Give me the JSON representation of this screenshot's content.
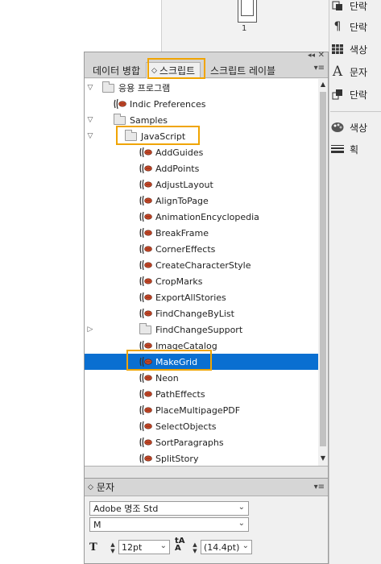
{
  "page_thumb": {
    "number": "1"
  },
  "right_panel": {
    "items": [
      {
        "label": "단락",
        "icon": "paragraph-style-icon"
      },
      {
        "label": "단락",
        "icon": "pilcrow-icon"
      },
      {
        "label": "색상",
        "icon": "swatch-grid-icon"
      },
      {
        "label": "문자",
        "icon": "character-icon"
      },
      {
        "label": "단락",
        "icon": "paragraph-styles-icon"
      },
      {
        "label": "색상",
        "icon": "color-palette-icon"
      },
      {
        "label": "획",
        "icon": "stroke-icon"
      }
    ]
  },
  "scripts_panel": {
    "tabs": [
      {
        "label": "데이터 병합"
      },
      {
        "label": "스크립트",
        "prefix": "◇"
      },
      {
        "label": "스크립트 레이블"
      }
    ],
    "tree": [
      {
        "label": "응용 프로그램",
        "type": "folder",
        "level": 0,
        "expanded": true
      },
      {
        "label": "Indic Preferences",
        "type": "script",
        "level": 1
      },
      {
        "label": "Samples",
        "type": "folder",
        "level": 1,
        "expanded": true
      },
      {
        "label": "JavaScript",
        "type": "folder",
        "level": 2,
        "expanded": true
      },
      {
        "label": "AddGuides",
        "type": "script",
        "level": 3
      },
      {
        "label": "AddPoints",
        "type": "script",
        "level": 3
      },
      {
        "label": "AdjustLayout",
        "type": "script",
        "level": 3
      },
      {
        "label": "AlignToPage",
        "type": "script",
        "level": 3
      },
      {
        "label": "AnimationEncyclopedia",
        "type": "script",
        "level": 3
      },
      {
        "label": "BreakFrame",
        "type": "script",
        "level": 3
      },
      {
        "label": "CornerEffects",
        "type": "script",
        "level": 3
      },
      {
        "label": "CreateCharacterStyle",
        "type": "script",
        "level": 3
      },
      {
        "label": "CropMarks",
        "type": "script",
        "level": 3
      },
      {
        "label": "ExportAllStories",
        "type": "script",
        "level": 3
      },
      {
        "label": "FindChangeByList",
        "type": "script",
        "level": 3
      },
      {
        "label": "FindChangeSupport",
        "type": "folder",
        "level": 3,
        "expanded": false
      },
      {
        "label": "ImageCatalog",
        "type": "script",
        "level": 3
      },
      {
        "label": "MakeGrid",
        "type": "script",
        "level": 3,
        "selected": true
      },
      {
        "label": "Neon",
        "type": "script",
        "level": 3
      },
      {
        "label": "PathEffects",
        "type": "script",
        "level": 3
      },
      {
        "label": "PlaceMultipagePDF",
        "type": "script",
        "level": 3
      },
      {
        "label": "SelectObjects",
        "type": "script",
        "level": 3
      },
      {
        "label": "SortParagraphs",
        "type": "script",
        "level": 3
      },
      {
        "label": "SplitStory",
        "type": "script",
        "level": 3
      }
    ]
  },
  "char_panel": {
    "title": "문자",
    "title_prefix": "◇",
    "font": "Adobe 명조 Std",
    "style": "M",
    "size": "12pt",
    "leading": "(14.4pt)"
  },
  "colors": {
    "highlight": "#f0a400",
    "selection": "#0a6fd1"
  }
}
